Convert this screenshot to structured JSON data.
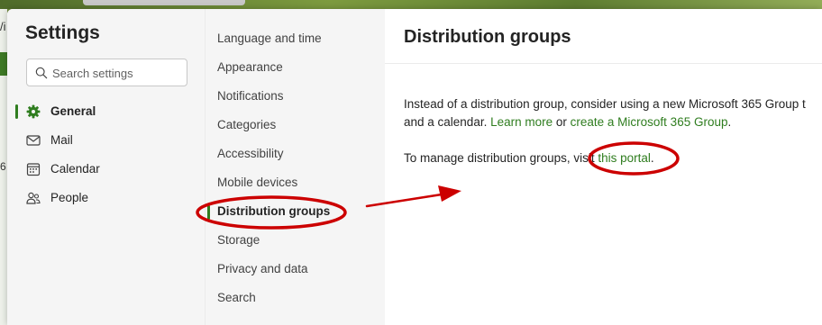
{
  "background": {
    "left_text": "/i",
    "left_number": "6"
  },
  "sidebar": {
    "title": "Settings",
    "search_placeholder": "Search settings",
    "items": [
      {
        "label": "General",
        "icon": "gear-icon",
        "active": true
      },
      {
        "label": "Mail",
        "icon": "mail-icon",
        "active": false
      },
      {
        "label": "Calendar",
        "icon": "calendar-icon",
        "active": false
      },
      {
        "label": "People",
        "icon": "people-icon",
        "active": false
      }
    ]
  },
  "subnav": {
    "items": [
      {
        "label": "Language and time"
      },
      {
        "label": "Appearance"
      },
      {
        "label": "Notifications"
      },
      {
        "label": "Categories"
      },
      {
        "label": "Accessibility"
      },
      {
        "label": "Mobile devices"
      },
      {
        "label": "Distribution groups",
        "active": true
      },
      {
        "label": "Storage"
      },
      {
        "label": "Privacy and data"
      },
      {
        "label": "Search"
      }
    ]
  },
  "main": {
    "title": "Distribution groups",
    "para1_line1": "Instead of a distribution group, consider using a new Microsoft 365 Group t",
    "para1_line2_prefix": "and a calendar. ",
    "learn_more": "Learn more",
    "or_text": " or ",
    "create_group": "create a Microsoft 365 Group",
    "para1_suffix": ".",
    "para2_prefix": "To manage distribution groups, visit ",
    "portal_link": "this portal",
    "para2_suffix": "."
  },
  "colors": {
    "accent": "#2f7d1f",
    "annotation": "#cc0000"
  }
}
